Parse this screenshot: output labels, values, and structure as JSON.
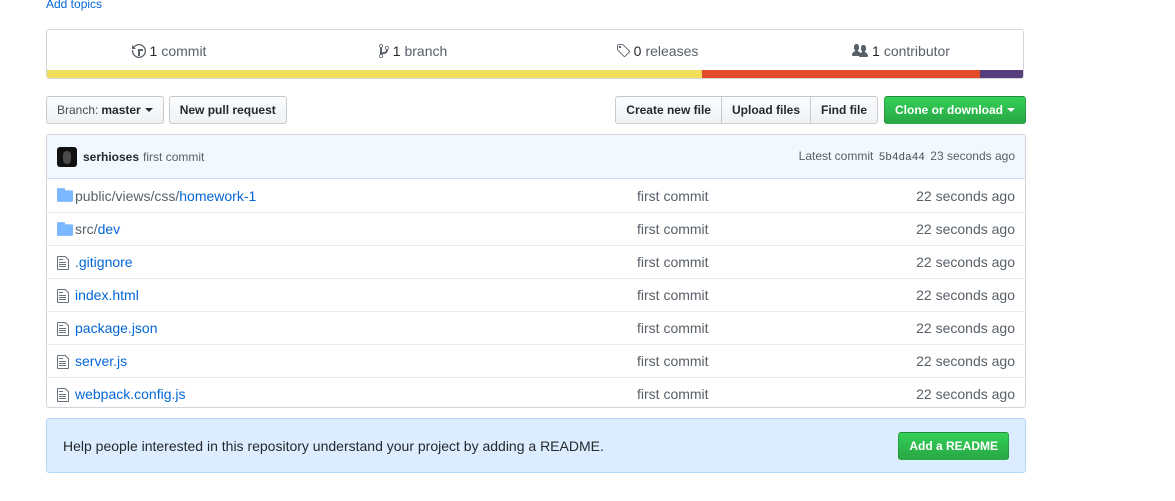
{
  "add_topics": "Add topics",
  "summary": {
    "commits": {
      "count": "1",
      "label": "commit",
      "icon": "history-icon"
    },
    "branches": {
      "count": "1",
      "label": "branch",
      "icon": "branch-icon"
    },
    "releases": {
      "count": "0",
      "label": "releases",
      "icon": "tag-icon"
    },
    "contributors": {
      "count": "1",
      "label": "contributor",
      "icon": "people-icon"
    },
    "languages": [
      {
        "color": "#f1e05a",
        "percent": 67.1
      },
      {
        "color": "#e34c26",
        "percent": 28.5
      },
      {
        "color": "#563d7c",
        "percent": 3.8
      }
    ]
  },
  "toolbar": {
    "branch_prefix": "Branch:",
    "branch_name": "master",
    "new_pr": "New pull request",
    "create_file": "Create new file",
    "upload_files": "Upload files",
    "find_file": "Find file",
    "clone": "Clone or download"
  },
  "commit_tease": {
    "author": "serhioses",
    "message": "first commit",
    "latest_label": "Latest commit",
    "sha": "5b4da44",
    "time": "23 seconds ago"
  },
  "files": [
    {
      "type": "dir",
      "dim": "public/views/css/",
      "name": "homework-1",
      "message": "first commit",
      "age": "22 seconds ago"
    },
    {
      "type": "dir",
      "dim": "src/",
      "name": "dev",
      "message": "first commit",
      "age": "22 seconds ago"
    },
    {
      "type": "file",
      "dim": "",
      "name": ".gitignore",
      "message": "first commit",
      "age": "22 seconds ago"
    },
    {
      "type": "file",
      "dim": "",
      "name": "index.html",
      "message": "first commit",
      "age": "22 seconds ago"
    },
    {
      "type": "file",
      "dim": "",
      "name": "package.json",
      "message": "first commit",
      "age": "22 seconds ago"
    },
    {
      "type": "file",
      "dim": "",
      "name": "server.js",
      "message": "first commit",
      "age": "22 seconds ago"
    },
    {
      "type": "file",
      "dim": "",
      "name": "webpack.config.js",
      "message": "first commit",
      "age": "22 seconds ago"
    }
  ],
  "readme": {
    "text": "Help people interested in this repository understand your project by adding a README.",
    "button": "Add a README"
  },
  "colors": {
    "link": "#0366d6",
    "green": "#28a745",
    "folder": "#79b8ff"
  }
}
